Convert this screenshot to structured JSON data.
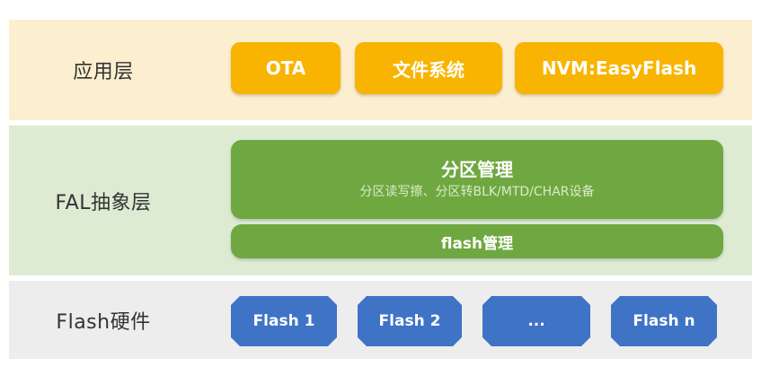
{
  "colors": {
    "app_bg": "#FCEFCF",
    "app_box": "#F8B400",
    "fal_bg": "#DDEBD3",
    "fal_box": "#6FA840",
    "fal_sub_text": "#DCEBCB",
    "hw_bg": "#EDEDED",
    "hw_box": "#3E73C6"
  },
  "layers": {
    "app": {
      "label": "应用层",
      "boxes": [
        "OTA",
        "文件系统",
        "NVM:EasyFlash"
      ]
    },
    "fal": {
      "label": "FAL抽象层",
      "partition_title": "分区管理",
      "partition_subtitle": "分区读写擦、分区转BLK/MTD/CHAR设备",
      "flash_manage": "flash管理"
    },
    "hardware": {
      "label": "Flash硬件",
      "boxes": [
        "Flash 1",
        "Flash 2",
        "...",
        "Flash n"
      ]
    }
  }
}
